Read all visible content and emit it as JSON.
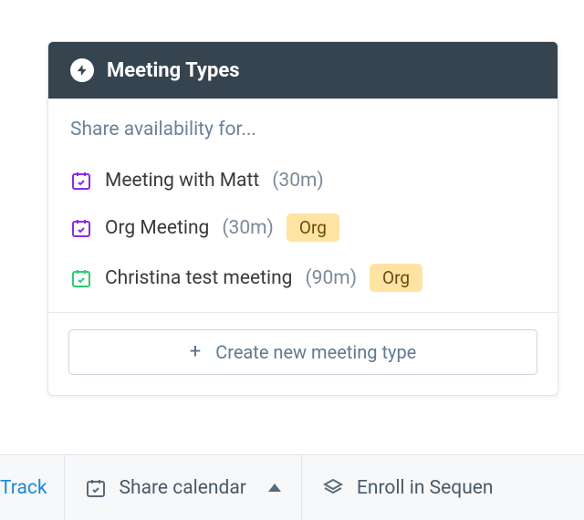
{
  "panel": {
    "title": "Meeting Types",
    "share_label": "Share availability for...",
    "meetings": [
      {
        "name": "Meeting with Matt",
        "duration": "(30m)",
        "badge": null,
        "color": "#8a2be2"
      },
      {
        "name": "Org Meeting",
        "duration": "(30m)",
        "badge": "Org",
        "color": "#8a2be2"
      },
      {
        "name": "Christina test meeting",
        "duration": "(90m)",
        "badge": "Org",
        "color": "#2ecc71"
      }
    ],
    "create_label": "Create new meeting type"
  },
  "toolbar": {
    "track_label": "Track",
    "share_calendar_label": "Share calendar",
    "enroll_label": "Enroll in Sequen"
  }
}
